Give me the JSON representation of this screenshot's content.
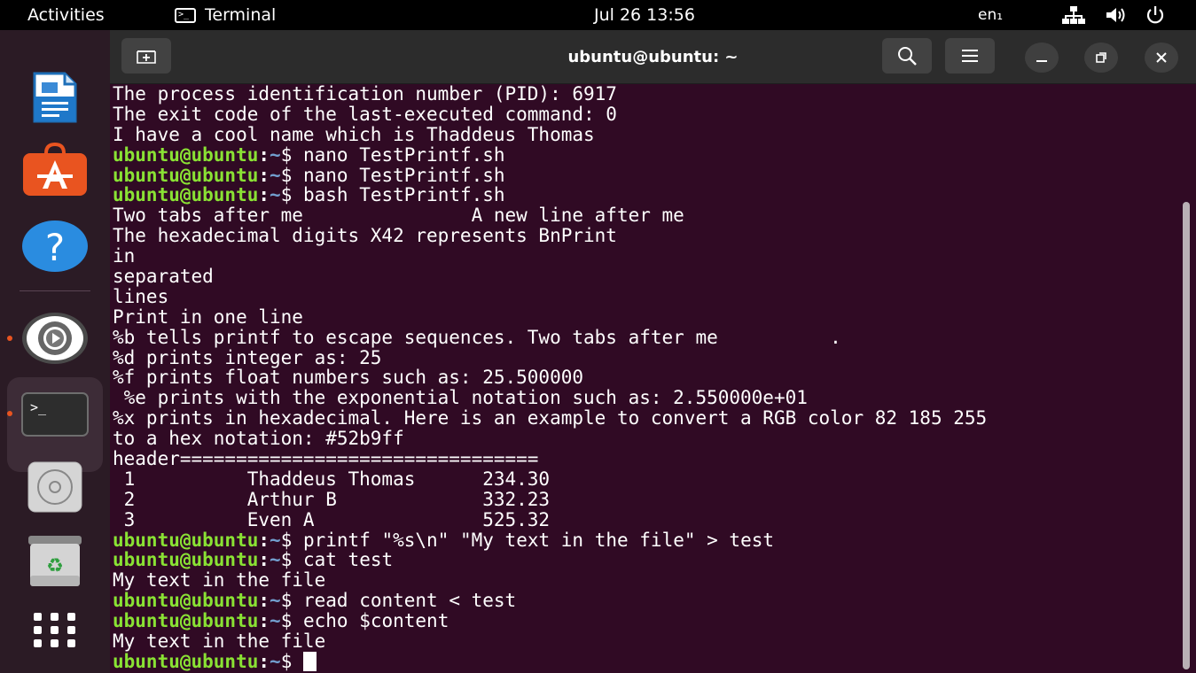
{
  "topbar": {
    "activities": "Activities",
    "app_name": "Terminal",
    "clock": "Jul 26  13:56",
    "input_lang": "en₁",
    "icons": [
      "network-icon",
      "volume-icon",
      "power-icon"
    ]
  },
  "dock": {
    "items": [
      "libreoffice-writer-icon",
      "ubuntu-software-icon",
      "help-icon",
      "settings-icon",
      "terminal-icon",
      "disc-icon",
      "trash-icon",
      "show-apps-icon"
    ]
  },
  "window": {
    "title": "ubuntu@ubuntu: ~",
    "icons": [
      "new-tab-icon",
      "search-icon",
      "menu-icon",
      "minimize-icon",
      "maximize-icon",
      "close-icon"
    ]
  },
  "terminal": {
    "prompt_user": "ubuntu@ubuntu",
    "prompt_colon": ":",
    "prompt_path": "~",
    "prompt_symbol": "$ ",
    "lines": [
      {
        "type": "out",
        "text": "The process identification number (PID): 6917"
      },
      {
        "type": "out",
        "text": "The exit code of the last-executed command: 0"
      },
      {
        "type": "out",
        "text": "I have a cool name which is Thaddeus Thomas"
      },
      {
        "type": "cmd",
        "text": "nano TestPrintf.sh"
      },
      {
        "type": "cmd",
        "text": "nano TestPrintf.sh"
      },
      {
        "type": "cmd",
        "text": "bash TestPrintf.sh"
      },
      {
        "type": "out",
        "text": "Two tabs after me               A new line after me"
      },
      {
        "type": "out",
        "text": "The hexadecimal digits X42 represents BnPrint"
      },
      {
        "type": "out",
        "text": "in"
      },
      {
        "type": "out",
        "text": "separated"
      },
      {
        "type": "out",
        "text": "lines"
      },
      {
        "type": "out",
        "text": "Print in one line"
      },
      {
        "type": "out",
        "text": "%b tells printf to escape sequences. Two tabs after me          ."
      },
      {
        "type": "out",
        "text": "%d prints integer as: 25"
      },
      {
        "type": "out",
        "text": "%f prints float numbers such as: 25.500000"
      },
      {
        "type": "out",
        "text": " %e prints with the exponential notation such as: 2.550000e+01"
      },
      {
        "type": "out",
        "text": "%x prints in hexadecimal. Here is an example to convert a RGB color 82 185 255"
      },
      {
        "type": "out",
        "text": "to a hex notation: #52b9ff"
      },
      {
        "type": "out",
        "text": "header================================"
      },
      {
        "type": "out",
        "text": " 1          Thaddeus Thomas      234.30"
      },
      {
        "type": "out",
        "text": " 2          Arthur B             332.23"
      },
      {
        "type": "out",
        "text": " 3          Even A               525.32"
      },
      {
        "type": "cmd",
        "text": "printf \"%s\\n\" \"My text in the file\" > test"
      },
      {
        "type": "cmd",
        "text": "cat test"
      },
      {
        "type": "out",
        "text": "My text in the file"
      },
      {
        "type": "cmd",
        "text": "read content < test"
      },
      {
        "type": "cmd",
        "text": "echo $content"
      },
      {
        "type": "out",
        "text": "My text in the file"
      },
      {
        "type": "cmd",
        "text": "",
        "cursor": true
      }
    ]
  }
}
